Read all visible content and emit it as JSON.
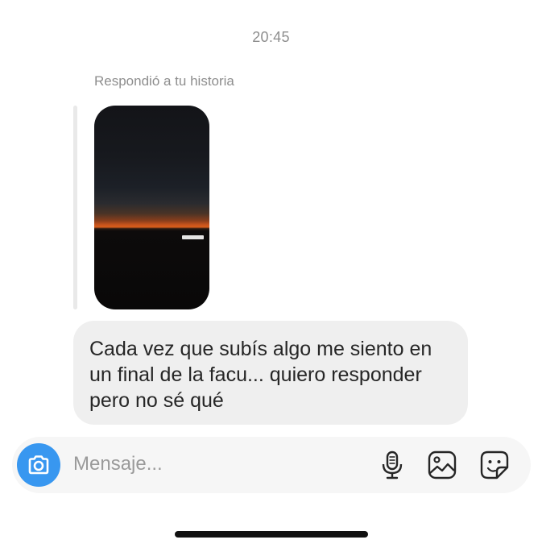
{
  "chat": {
    "timestamp": "20:45",
    "story_reply": {
      "caption": "Respondió a tu historia"
    },
    "messages": [
      {
        "text": "Cada vez que subís algo me siento en un final de la facu... quiero responder pero no sé qué"
      }
    ]
  },
  "composer": {
    "placeholder": "Mensaje...",
    "icons": [
      "camera-icon",
      "microphone-icon",
      "gallery-icon",
      "sticker-icon"
    ]
  },
  "colors": {
    "accent": "#3897f0",
    "bubble": "#efefef",
    "muted_text": "#8e8e8e",
    "composer_bg": "#f6f6f6"
  }
}
